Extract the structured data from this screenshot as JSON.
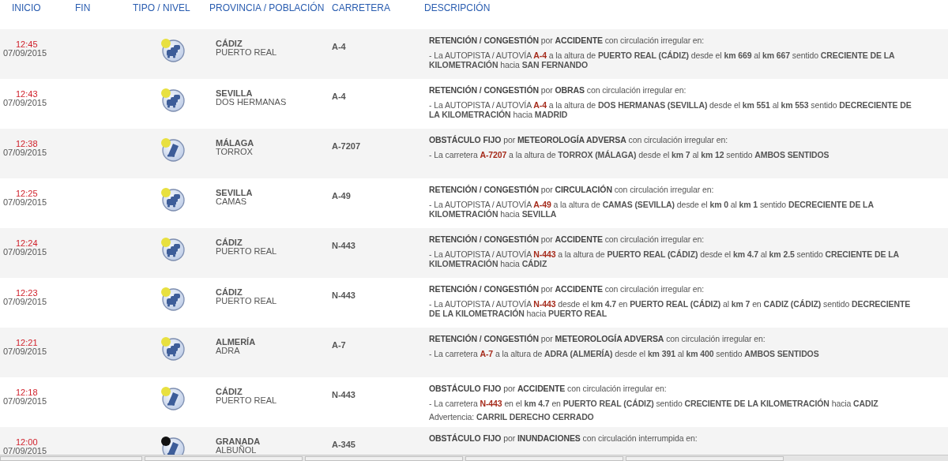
{
  "columns": [
    "INICIO",
    "FIN",
    "TIPO / NIVEL",
    "PROVINCIA / POBLACIÓN",
    "CARRETERA",
    "DESCRIPCIÓN"
  ],
  "rows": [
    {
      "time": "12:45",
      "date": "07/09/2015",
      "kind": "congestion",
      "color": "#e8e040",
      "province": "CÁDIZ",
      "town": "PUERTO REAL",
      "road": "A-4",
      "title": "**RETENCIÓN / CONGESTIÓN** por **ACCIDENTE** con circulación irregular en:",
      "detail": {
        "prefix": "- La AUTOPISTA / AUTOVÍA ",
        "road": "A-4",
        "suffix": " a la altura de **PUERTO REAL (CÁDIZ)** desde el **km 669** al **km 667** sentido **CRECIENTE DE LA KILOMETRACIÓN** hacia **SAN FERNANDO**"
      }
    },
    {
      "time": "12:43",
      "date": "07/09/2015",
      "kind": "congestion",
      "color": "#e8e040",
      "province": "SEVILLA",
      "town": "DOS HERMANAS",
      "road": "A-4",
      "title": "**RETENCIÓN / CONGESTIÓN** por **OBRAS** con circulación irregular en:",
      "detail": {
        "prefix": "- La AUTOPISTA / AUTOVÍA ",
        "road": "A-4",
        "suffix": " a la altura de **DOS HERMANAS (SEVILLA)** desde el **km 551** al **km 553** sentido **DECRECIENTE DE LA KILOMETRACIÓN** hacia **MADRID**"
      }
    },
    {
      "time": "12:38",
      "date": "07/09/2015",
      "kind": "obstacle",
      "color": "#e8e040",
      "province": "MÁLAGA",
      "town": "TORROX",
      "road": "A-7207",
      "title": "**OBSTÁCULO FIJO** por **METEOROLOGÍA ADVERSA** con circulación irregular en:",
      "detail": {
        "prefix": "- La carretera ",
        "road": "A-7207",
        "suffix": " a la altura de **TORROX (MÁLAGA)** desde el **km 7** al **km 12** sentido **AMBOS SENTIDOS**"
      }
    },
    {
      "time": "12:25",
      "date": "07/09/2015",
      "kind": "congestion",
      "color": "#e8e040",
      "province": "SEVILLA",
      "town": "CAMAS",
      "road": "A-49",
      "title": "**RETENCIÓN / CONGESTIÓN** por **CIRCULACIÓN** con circulación irregular en:",
      "detail": {
        "prefix": "- La AUTOPISTA / AUTOVÍA ",
        "road": "A-49",
        "suffix": " a la altura de **CAMAS (SEVILLA)** desde el **km 0** al **km 1** sentido **DECRECIENTE DE LA KILOMETRACIÓN** hacia **SEVILLA**"
      }
    },
    {
      "time": "12:24",
      "date": "07/09/2015",
      "kind": "congestion",
      "color": "#e8e040",
      "province": "CÁDIZ",
      "town": "PUERTO REAL",
      "road": "N-443",
      "title": "**RETENCIÓN / CONGESTIÓN** por **ACCIDENTE** con circulación irregular en:",
      "detail": {
        "prefix": "- La AUTOPISTA / AUTOVÍA ",
        "road": "N-443",
        "suffix": " a la altura de **PUERTO REAL (CÁDIZ)** desde el **km 4.7** al **km 2.5** sentido **CRECIENTE DE LA KILOMETRACIÓN** hacia **CÁDIZ**"
      }
    },
    {
      "time": "12:23",
      "date": "07/09/2015",
      "kind": "congestion",
      "color": "#e8e040",
      "province": "CÁDIZ",
      "town": "PUERTO REAL",
      "road": "N-443",
      "title": "**RETENCIÓN / CONGESTIÓN** por **ACCIDENTE** con circulación irregular en:",
      "detail": {
        "prefix": "- La AUTOPISTA / AUTOVÍA ",
        "road": "N-443",
        "suffix": " desde el **km 4.7** en **PUERTO REAL (CÁDIZ)** al **km 7** en **CADIZ (CÁDIZ)** sentido **DECRECIENTE DE LA KILOMETRACIÓN** hacia **PUERTO REAL**"
      }
    },
    {
      "time": "12:21",
      "date": "07/09/2015",
      "kind": "congestion",
      "color": "#e8e040",
      "province": "ALMERÍA",
      "town": "ADRA",
      "road": "A-7",
      "title": "**RETENCIÓN / CONGESTIÓN** por **METEOROLOGÍA ADVERSA** con circulación irregular en:",
      "detail": {
        "prefix": "- La carretera ",
        "road": "A-7",
        "suffix": " a la altura de **ADRA (ALMERÍA)** desde el **km 391** al **km 400** sentido **AMBOS SENTIDOS**"
      }
    },
    {
      "time": "12:18",
      "date": "07/09/2015",
      "kind": "obstacle",
      "color": "#e8e040",
      "province": "CÁDIZ",
      "town": "PUERTO REAL",
      "road": "N-443",
      "title": "**OBSTÁCULO FIJO** por **ACCIDENTE** con circulación irregular en:",
      "detail": {
        "prefix": "- La carretera ",
        "road": "N-443",
        "suffix": " en el **km 4.7** en **PUERTO REAL (CÁDIZ)** sentido **CRECIENTE DE LA KILOMETRACIÓN** hacia **CADIZ**"
      },
      "warning": "Advertencia: **CARRIL DERECHO CERRADO**"
    },
    {
      "time": "12:00",
      "date": "07/09/2015",
      "kind": "obstacle",
      "color": "#111111",
      "province": "GRANADA",
      "town": "ALBUÑOL",
      "road": "A-345",
      "title": "**OBSTÁCULO FIJO** por **INUNDACIONES** con circulación interrumpida en:"
    }
  ]
}
